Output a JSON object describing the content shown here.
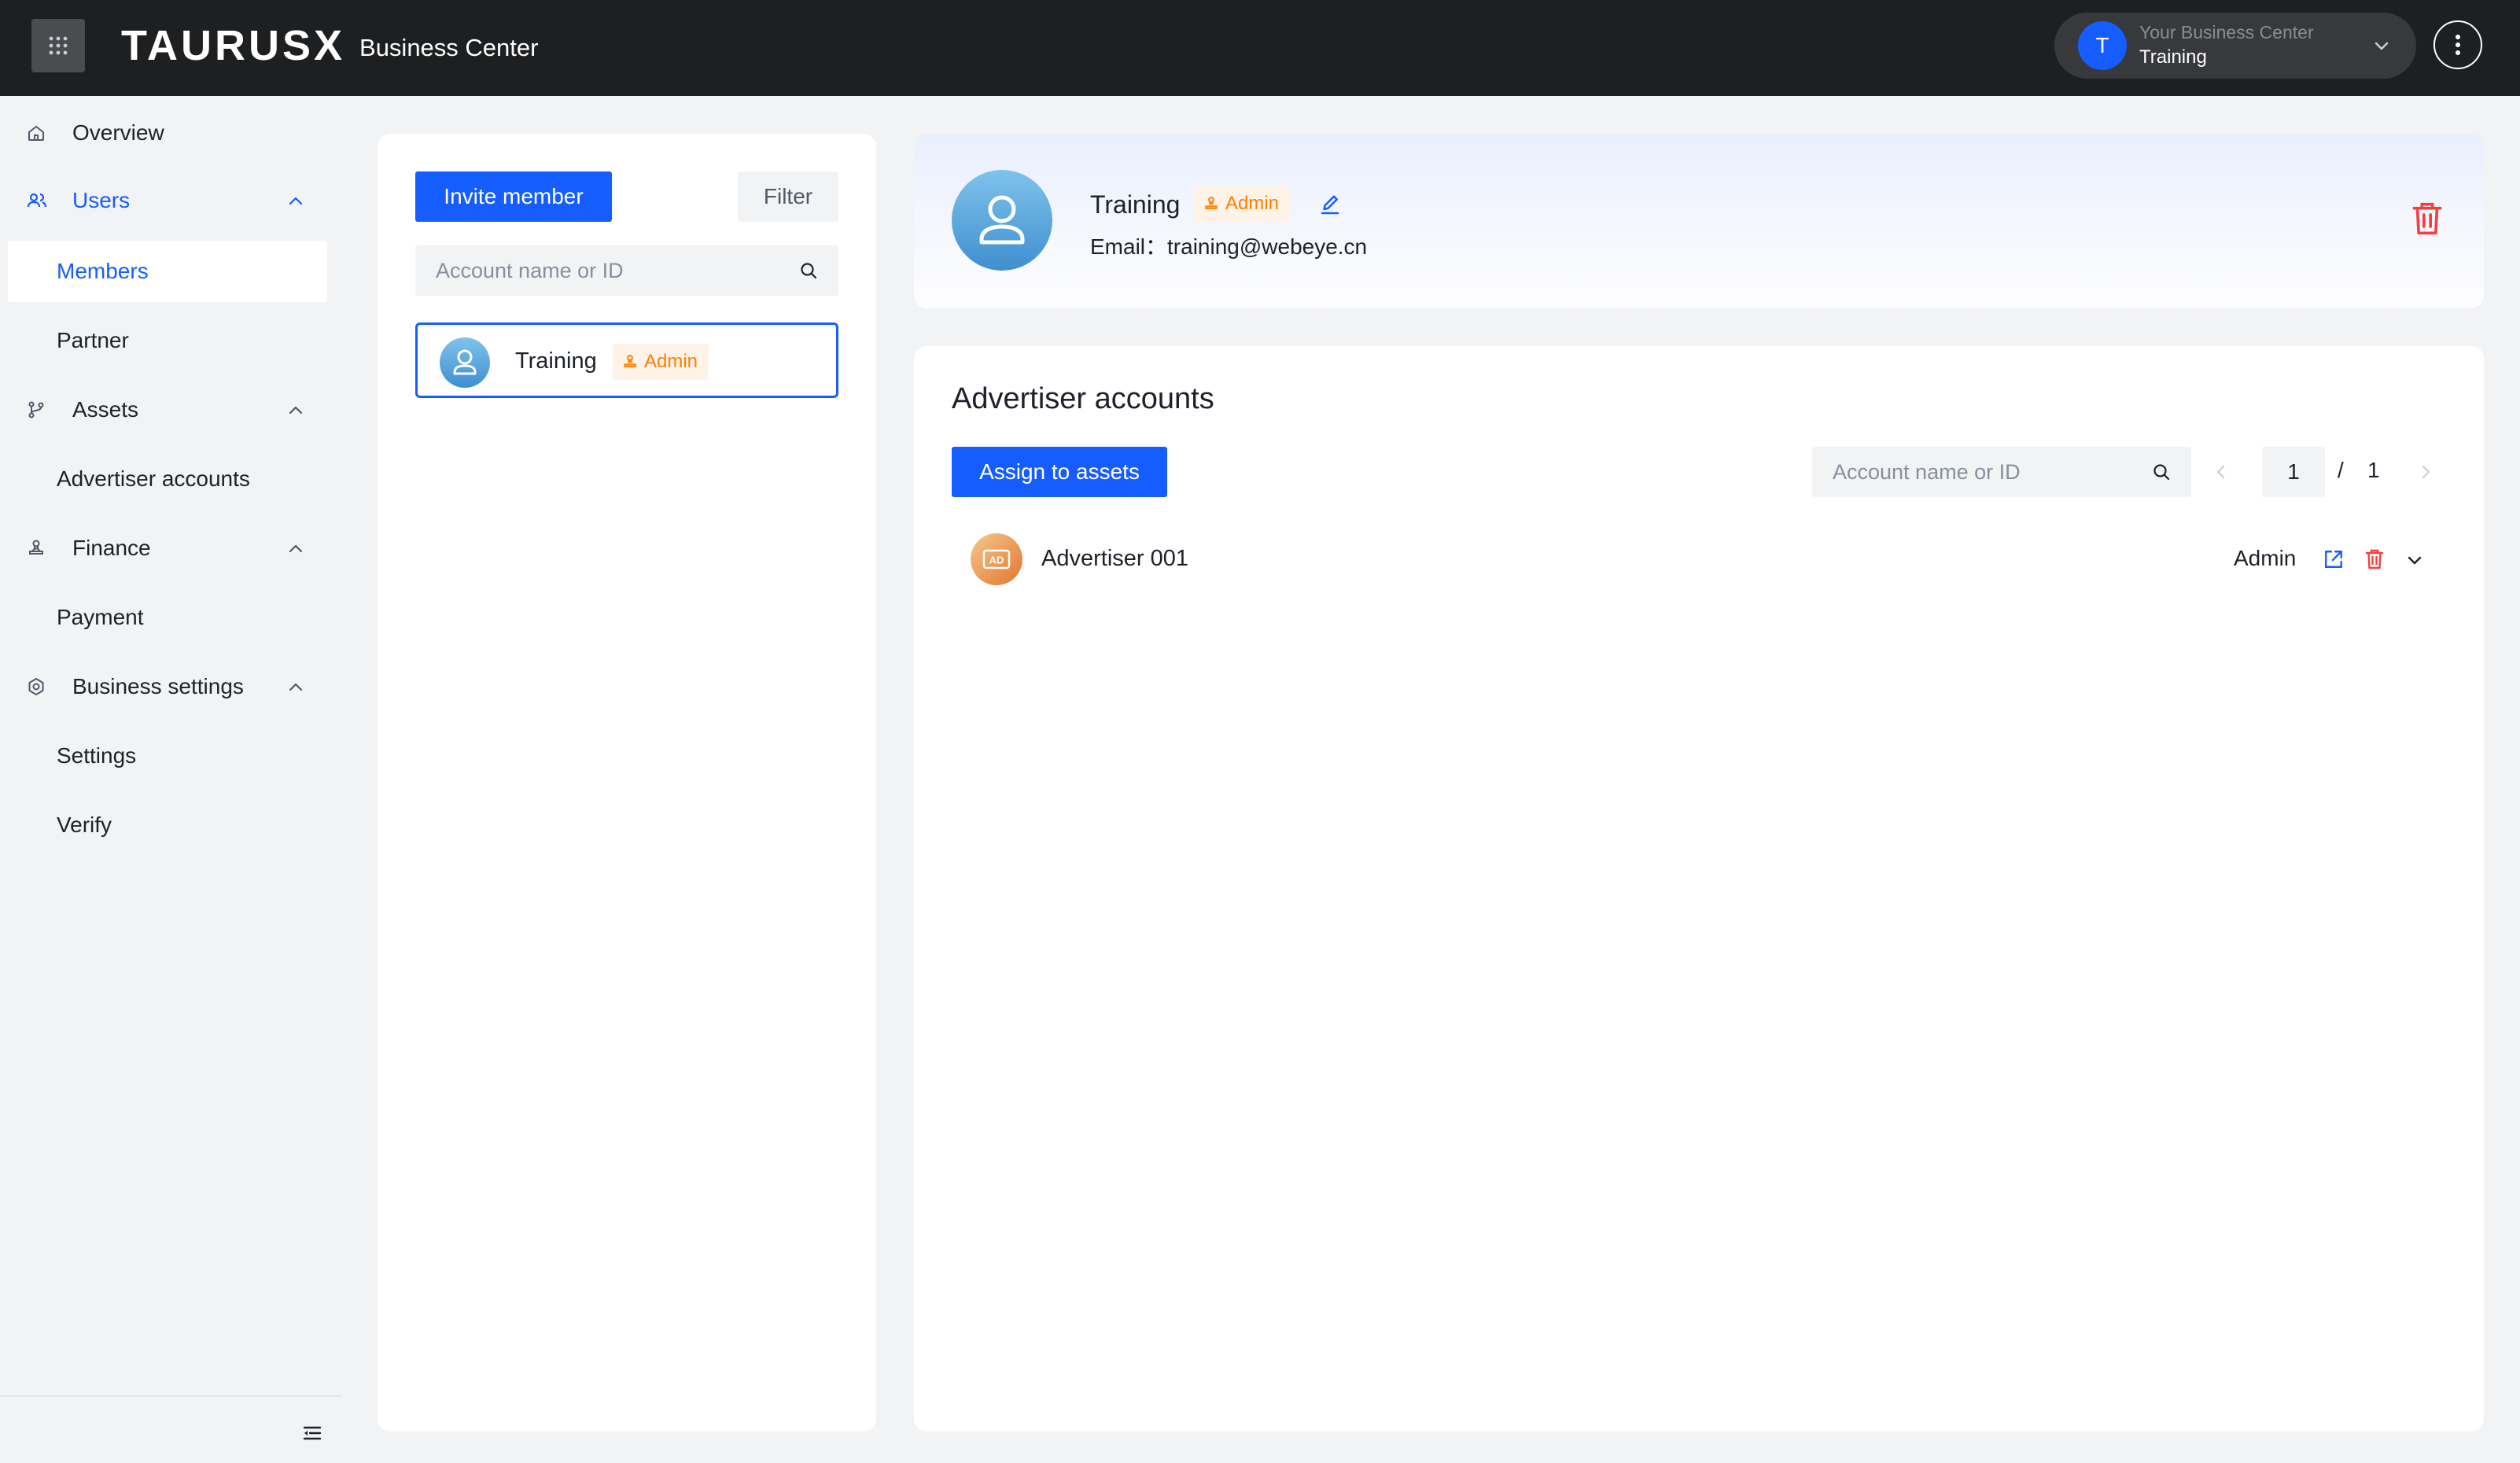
{
  "header": {
    "brand": "TAURUSX",
    "product": "Business Center",
    "bc_label": "Your Business Center",
    "bc_name": "Training",
    "bc_initial": "T"
  },
  "sidebar": {
    "overview": "Overview",
    "users": "Users",
    "members": "Members",
    "partner": "Partner",
    "assets": "Assets",
    "advertiser_accounts": "Advertiser accounts",
    "finance": "Finance",
    "payment": "Payment",
    "business_settings": "Business settings",
    "settings": "Settings",
    "verify": "Verify"
  },
  "members_panel": {
    "invite_label": "Invite member",
    "filter_label": "Filter",
    "search_placeholder": "Account name or ID",
    "members": [
      {
        "name": "Training",
        "role": "Admin"
      }
    ]
  },
  "detail": {
    "name": "Training",
    "role": "Admin",
    "email": "Email：training@webeye.cn"
  },
  "accounts": {
    "title": "Advertiser accounts",
    "assign_label": "Assign to assets",
    "search_placeholder": "Account name or ID",
    "page_current": "1",
    "page_sep": "/",
    "page_total": "1",
    "rows": [
      {
        "avatar_text": "AD",
        "name": "Advertiser 001",
        "role": "Admin"
      }
    ]
  },
  "colors": {
    "primary": "#165dff",
    "admin_badge_text": "#ff7d00",
    "admin_badge_bg": "#fff3e8",
    "danger": "#f53f3f",
    "topbar": "#1e1f21"
  },
  "icons": {
    "apps": "grid-icon",
    "overview": "home-icon",
    "users": "users-icon",
    "assets": "branch-icon",
    "finance": "stamp-icon",
    "settings": "gear-icon",
    "search": "search-icon",
    "edit": "pencil-icon",
    "delete": "trash-icon",
    "open": "external-link-icon",
    "collapse": "menu-collapse-icon"
  }
}
